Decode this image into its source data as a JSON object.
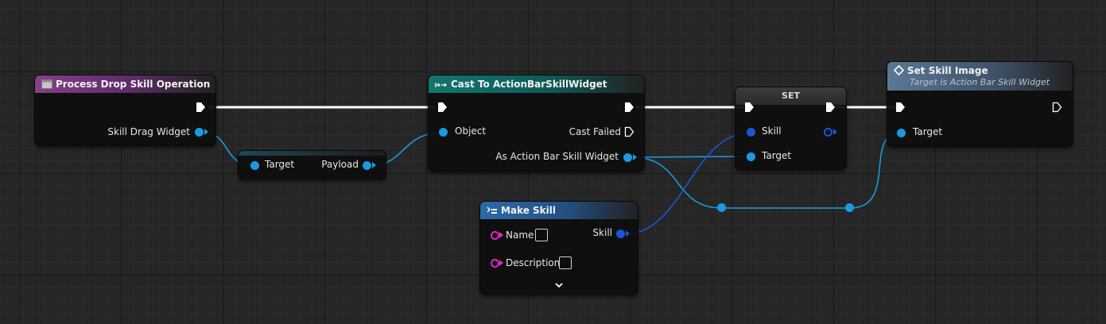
{
  "colors": {
    "exec_wire": "#ffffff",
    "object_wire": "#1a9ae0",
    "struct_wire": "#1b55d6",
    "string_pin": "#e026c8"
  },
  "nodes": {
    "process_drop": {
      "title": "Process Drop Skill Operation",
      "icon": "function-icon",
      "pin_skill_drag_widget": "Skill Drag Widget"
    },
    "get_payload": {
      "pin_target": "Target",
      "pin_payload": "Payload"
    },
    "cast": {
      "title": "Cast To ActionBarSkillWidget",
      "icon": "cast-icon",
      "pin_object": "Object",
      "pin_cast_failed": "Cast Failed",
      "pin_as_widget": "As Action Bar Skill Widget"
    },
    "set": {
      "title": "SET",
      "pin_skill": "Skill",
      "pin_target": "Target"
    },
    "set_skill_image": {
      "title": "Set Skill Image",
      "subtitle": "Target is Action Bar Skill Widget",
      "icon": "function-diamond-icon",
      "pin_target": "Target"
    },
    "make_skill": {
      "title": "Make Skill",
      "icon": "make-struct-icon",
      "pin_name": "Name",
      "pin_description": "Description",
      "pin_skill": "Skill",
      "name_value": "",
      "description_value": ""
    }
  }
}
